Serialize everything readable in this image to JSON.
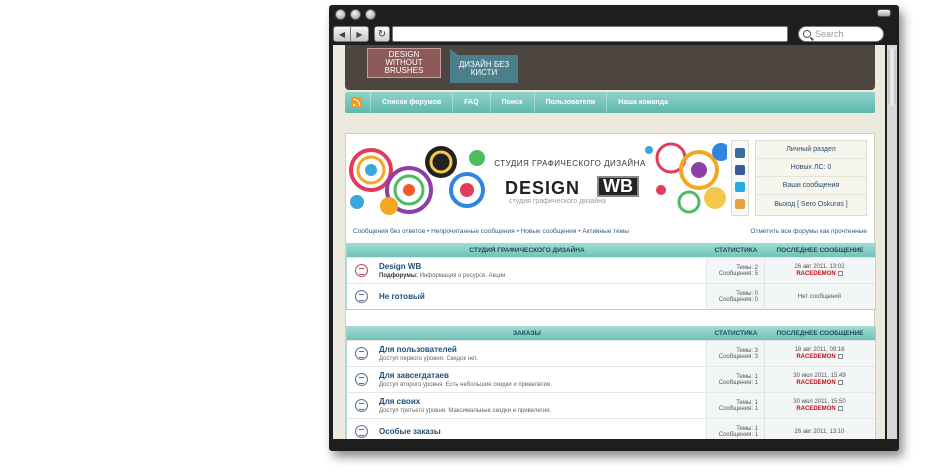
{
  "browser": {
    "search_placeholder": "Search"
  },
  "site": {
    "logo_tab_1": "DESIGN WITHOUT BRUSHES",
    "logo_tab_2": "ДИЗАЙН БЕЗ КИСТИ",
    "nav": [
      "Список форумов",
      "FAQ",
      "Поиск",
      "Пользователи",
      "Наша команда"
    ]
  },
  "banner": {
    "title_small": "СТУДИЯ ГРАФИЧЕСКОГО ДИЗАЙНА",
    "title_big": "DESIGN",
    "title_box": "WB",
    "subtitle": "студия графического дизайна"
  },
  "user_panel": {
    "personal": "Личный раздел",
    "new_pm": "Новых ЛС: 0",
    "your_posts": "Ваши сообщения",
    "logout": "Выход [ Sero Oskuras ]"
  },
  "quick_links": "Сообщения без ответов • Непрочитанные сообщения • Новые сообщения • Активные темы",
  "mark_all_read": "Отметить все форумы как прочтенные",
  "blocks": [
    {
      "title": "Студия графического дизайна",
      "stats_label": "Статистика",
      "last_label": "Последнее сообщение",
      "forums": [
        {
          "title": "Design WB",
          "desc_label": "Подфорумы:",
          "desc": "Информация о ресурсе, Акции",
          "topics": "Темы: 2",
          "posts": "Сообщения: 5",
          "last_date": "26 авг 2011, 13:02",
          "last_author": "RACEDEMON",
          "has_new": true
        },
        {
          "title": "Не готовый",
          "desc_label": "",
          "desc": "",
          "topics": "Темы: 0",
          "posts": "Сообщения: 0",
          "last_date": "Нет сообщений",
          "last_author": "",
          "has_new": false
        }
      ]
    },
    {
      "title": "Заказы",
      "stats_label": "Статистика",
      "last_label": "Последнее сообщение",
      "forums": [
        {
          "title": "Для пользователей",
          "desc_label": "",
          "desc": "Доступ первого уровня. Скидок нет.",
          "topics": "Темы: 3",
          "posts": "Сообщения: 3",
          "last_date": "18 авг 2011, 09:16",
          "last_author": "RACEDEMON",
          "has_new": false
        },
        {
          "title": "Для завсегдатаев",
          "desc_label": "",
          "desc": "Доступ второго уровня. Есть небольшие скидки и привелегии.",
          "topics": "Темы: 1",
          "posts": "Сообщения: 1",
          "last_date": "30 июл 2011, 15:49",
          "last_author": "RACEDEMON",
          "has_new": false
        },
        {
          "title": "Для своих",
          "desc_label": "",
          "desc": "Доступ третьего уровня. Максимальные скидки и привелегии.",
          "topics": "Темы: 1",
          "posts": "Сообщения: 1",
          "last_date": "30 июл 2011, 15:50",
          "last_author": "RACEDEMON",
          "has_new": false
        },
        {
          "title": "Особые заказы",
          "desc_label": "",
          "desc": "",
          "topics": "Темы: 1",
          "posts": "Сообщения: 1",
          "last_date": "26 авг 2011, 13:10",
          "last_author": "",
          "has_new": false
        }
      ]
    }
  ]
}
